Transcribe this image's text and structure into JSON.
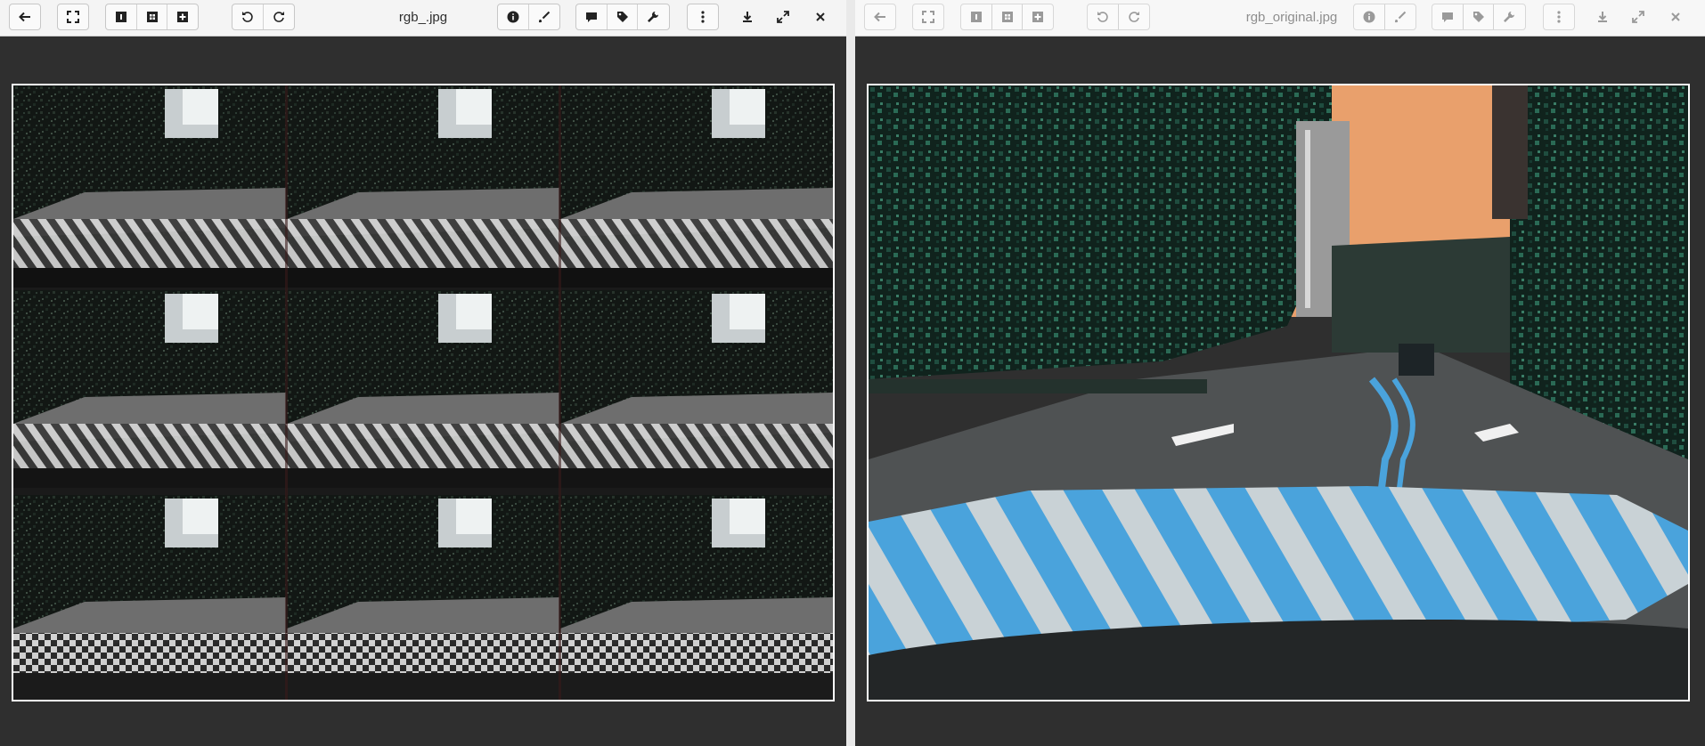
{
  "left_viewer": {
    "title": "rgb_.jpg",
    "state": "active",
    "image_alt": "tiled 3x3 RGB street scene"
  },
  "right_viewer": {
    "title": "rgb_original.jpg",
    "state": "inactive",
    "image_alt": "street scene with blue crosswalk"
  },
  "toolbar_icons": [
    "back-arrow-icon",
    "fit-to-window-icon",
    "single-image-icon",
    "grid-view-icon",
    "add-image-icon",
    "rotate-left-icon",
    "rotate-right-icon",
    "info-icon",
    "edit-brush-icon",
    "comment-icon",
    "tag-icon",
    "wrench-icon",
    "more-vertical-icon",
    "download-icon",
    "fullscreen-icon",
    "close-icon"
  ],
  "colors": {
    "toolbar_bg": "#f4f4f4",
    "viewer_bg": "#2f2f2f",
    "divider": "#e9e9e9",
    "crosswalk_blue": "#4aa3dc",
    "sky_orange": "#e9a06c"
  }
}
